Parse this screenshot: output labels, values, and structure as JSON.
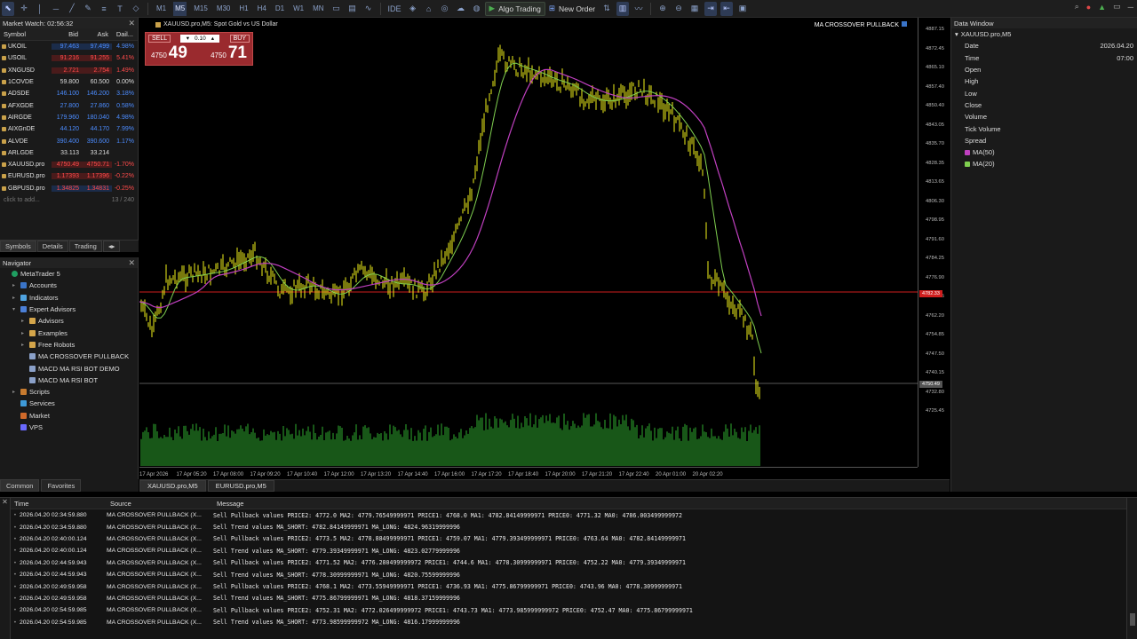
{
  "toolbar": {
    "timeframes": [
      "M1",
      "M5",
      "M15",
      "M30",
      "H1",
      "H4",
      "D1",
      "W1",
      "MN"
    ],
    "active_timeframe": "M5",
    "algo_trading_label": "Algo Trading",
    "new_order_label": "New Order"
  },
  "market_watch": {
    "title": "Market Watch: 02:56:32",
    "headers": [
      "Symbol",
      "Bid",
      "Ask",
      "Dail..."
    ],
    "rows": [
      {
        "symbol": "UKOIL",
        "bid": "97.463",
        "ask": "97.499",
        "change": "4.98%",
        "dir": "up",
        "hl": "hlb"
      },
      {
        "symbol": "USOIL",
        "bid": "91.216",
        "ask": "91.255",
        "change": "5.41%",
        "dir": "dn",
        "hl": "hl"
      },
      {
        "symbol": "XNGUSD",
        "bid": "2.721",
        "ask": "2.754",
        "change": "1.49%",
        "dir": "dn",
        "hl": "hl"
      },
      {
        "symbol": "1COVDE",
        "bid": "59.800",
        "ask": "60.500",
        "change": "0.00%",
        "dir": "",
        "hl": ""
      },
      {
        "symbol": "ADSDE",
        "bid": "146.100",
        "ask": "146.200",
        "change": "3.18%",
        "dir": "up",
        "hl": ""
      },
      {
        "symbol": "AFXGDE",
        "bid": "27.800",
        "ask": "27.860",
        "change": "0.58%",
        "dir": "up",
        "hl": ""
      },
      {
        "symbol": "AIRGDE",
        "bid": "179.960",
        "ask": "180.040",
        "change": "4.98%",
        "dir": "up",
        "hl": ""
      },
      {
        "symbol": "AIXGnDE",
        "bid": "44.120",
        "ask": "44.170",
        "change": "7.99%",
        "dir": "up",
        "hl": ""
      },
      {
        "symbol": "ALVDE",
        "bid": "390.400",
        "ask": "390.600",
        "change": "1.17%",
        "dir": "up",
        "hl": ""
      },
      {
        "symbol": "ARLGDE",
        "bid": "33.113",
        "ask": "33.214",
        "change": "",
        "dir": "",
        "hl": ""
      },
      {
        "symbol": "XAUUSD.pro",
        "bid": "4750.49",
        "ask": "4750.71",
        "change": "-1.70%",
        "dir": "dn",
        "hl": "hl"
      },
      {
        "symbol": "EURUSD.pro",
        "bid": "1.17393",
        "ask": "1.17396",
        "change": "-0.22%",
        "dir": "dn",
        "hl": "hl"
      },
      {
        "symbol": "GBPUSD.pro",
        "bid": "1.34825",
        "ask": "1.34831",
        "change": "-0.25%",
        "dir": "dn",
        "hl": "hlb"
      }
    ],
    "click_to_add": "click to add...",
    "count": "13 / 240",
    "tabs": [
      "Symbols",
      "Details",
      "Trading"
    ]
  },
  "navigator": {
    "title": "Navigator",
    "items": [
      {
        "label": "MetaTrader 5",
        "icon": "mt",
        "level": 0,
        "tw": ""
      },
      {
        "label": "Accounts",
        "icon": "acc",
        "level": 1,
        "tw": "▸"
      },
      {
        "label": "Indicators",
        "icon": "ind",
        "level": 1,
        "tw": "▸"
      },
      {
        "label": "Expert Advisors",
        "icon": "ea",
        "level": 1,
        "tw": "▾"
      },
      {
        "label": "Advisors",
        "icon": "fold",
        "level": 2,
        "tw": "▸"
      },
      {
        "label": "Examples",
        "icon": "fold",
        "level": 2,
        "tw": "▸"
      },
      {
        "label": "Free Robots",
        "icon": "fold",
        "level": 2,
        "tw": "▸"
      },
      {
        "label": "MA CROSSOVER PULLBACK",
        "icon": "robot",
        "level": 2,
        "tw": ""
      },
      {
        "label": "MACD MA RSI BOT DEMO",
        "icon": "robot",
        "level": 2,
        "tw": ""
      },
      {
        "label": "MACD MA RSI BOT",
        "icon": "robot",
        "level": 2,
        "tw": ""
      },
      {
        "label": "Scripts",
        "icon": "scr",
        "level": 1,
        "tw": "▸"
      },
      {
        "label": "Services",
        "icon": "svc",
        "level": 1,
        "tw": ""
      },
      {
        "label": "Market",
        "icon": "mkt",
        "level": 1,
        "tw": ""
      },
      {
        "label": "VPS",
        "icon": "vps",
        "level": 1,
        "tw": ""
      }
    ],
    "bottom_tabs": [
      "Common",
      "Favorites"
    ]
  },
  "chart": {
    "title": "XAUUSD.pro,M5:  Spot Gold vs US Dollar",
    "ea_name": "MA CROSSOVER PULLBACK",
    "one_click": {
      "sell_label": "SELL",
      "buy_label": "BUY",
      "volume": "0.10",
      "sell_big": "4750",
      "sell_small": "49",
      "buy_big": "4750",
      "buy_small": "71"
    },
    "y_labels": [
      "4887.15",
      "4872.45",
      "4865.10",
      "4857.40",
      "4850.40",
      "4843.05",
      "4835.70",
      "4828.35",
      "4813.65",
      "4806.30",
      "4798.95",
      "4791.60",
      "4784.25",
      "4776.90",
      "4769.55",
      "4762.20",
      "4754.85",
      "4747.50",
      "4740.15",
      "4732.80",
      "4725.45"
    ],
    "x_labels": [
      "17 Apr 2026",
      "17 Apr 05:20",
      "17 Apr 08:00",
      "17 Apr 09:20",
      "17 Apr 10:40",
      "17 Apr 12:00",
      "17 Apr 13:20",
      "17 Apr 14:40",
      "17 Apr 16:00",
      "17 Apr 17:20",
      "17 Apr 18:40",
      "17 Apr 20:00",
      "17 Apr 21:20",
      "17 Apr 22:40",
      "20 Apr 01:00",
      "20 Apr 02:20"
    ],
    "tag_red": "4782.33",
    "tag_gray": "4750.49",
    "tabs": [
      "XAUUSD.pro,M5",
      "EURUSD.pro,M5"
    ]
  },
  "data_window": {
    "title": "Data Window",
    "symbol": "XAUUSD.pro,M5",
    "rows": [
      {
        "label": "Date",
        "value": "2026.04.20"
      },
      {
        "label": "Time",
        "value": "07:00"
      },
      {
        "label": "Open",
        "value": ""
      },
      {
        "label": "High",
        "value": ""
      },
      {
        "label": "Low",
        "value": ""
      },
      {
        "label": "Close",
        "value": ""
      },
      {
        "label": "Volume",
        "value": ""
      },
      {
        "label": "Tick Volume",
        "value": ""
      },
      {
        "label": "Spread",
        "value": ""
      },
      {
        "label": "MA(50)",
        "value": "",
        "color": "#c040c0"
      },
      {
        "label": "MA(20)",
        "value": "",
        "color": "#7fcf4f"
      }
    ]
  },
  "journal": {
    "headers": [
      "Time",
      "Source",
      "Message"
    ],
    "rows": [
      {
        "time": "2026.04.20 02:34:59.880",
        "source": "MA CROSSOVER PULLBACK (X...",
        "message": "Sell Pullback values PRICE2: 4772.0 MA2: 4779.76549999971 PRICE1: 4768.0 MA1: 4782.84149999971 PRICE0: 4771.32 MA0: 4786.003499999972"
      },
      {
        "time": "2026.04.20 02:34:59.880",
        "source": "MA CROSSOVER PULLBACK (X...",
        "message": "Sell Trend values MA_SHORT: 4782.84149999971 MA_LONG: 4824.96319999996"
      },
      {
        "time": "2026.04.20 02:40:00.124",
        "source": "MA CROSSOVER PULLBACK (X...",
        "message": "Sell Pullback values PRICE2: 4773.5 MA2: 4778.88499999971 PRICE1: 4759.07 MA1: 4779.393499999971 PRICE0: 4763.64 MA0: 4782.84149999971"
      },
      {
        "time": "2026.04.20 02:40:00.124",
        "source": "MA CROSSOVER PULLBACK (X...",
        "message": "Sell Trend values MA_SHORT: 4779.39349999971 MA_LONG: 4823.02779999996"
      },
      {
        "time": "2026.04.20 02:44:59.943",
        "source": "MA CROSSOVER PULLBACK (X...",
        "message": "Sell Pullback values PRICE2: 4771.52 MA2: 4776.280499999972 PRICE1: 4744.6 MA1: 4778.30999999971 PRICE0: 4752.22 MA0: 4779.39349999971"
      },
      {
        "time": "2026.04.20 02:44:59.943",
        "source": "MA CROSSOVER PULLBACK (X...",
        "message": "Sell Trend values MA_SHORT: 4778.30999999971 MA_LONG: 4820.75599999996"
      },
      {
        "time": "2026.04.20 02:49:59.958",
        "source": "MA CROSSOVER PULLBACK (X...",
        "message": "Sell Pullback values PRICE2: 4768.1 MA2: 4773.55949999971 PRICE1: 4736.93 MA1: 4775.86799999971 PRICE0: 4743.96 MA0: 4778.30999999971"
      },
      {
        "time": "2026.04.20 02:49:59.958",
        "source": "MA CROSSOVER PULLBACK (X...",
        "message": "Sell Trend values MA_SHORT: 4775.86799999971 MA_LONG: 4818.37159999996"
      },
      {
        "time": "2026.04.20 02:54:59.985",
        "source": "MA CROSSOVER PULLBACK (X...",
        "message": "Sell Pullback values PRICE2: 4752.31 MA2: 4772.026499999972 PRICE1: 4743.73 MA1: 4773.985999999972 PRICE0: 4752.47 MA0: 4775.86799999971"
      },
      {
        "time": "2026.04.20 02:54:59.985",
        "source": "MA CROSSOVER PULLBACK (X...",
        "message": "Sell Trend values MA_SHORT: 4773.98599999972 MA_LONG: 4816.17999999996"
      }
    ]
  }
}
